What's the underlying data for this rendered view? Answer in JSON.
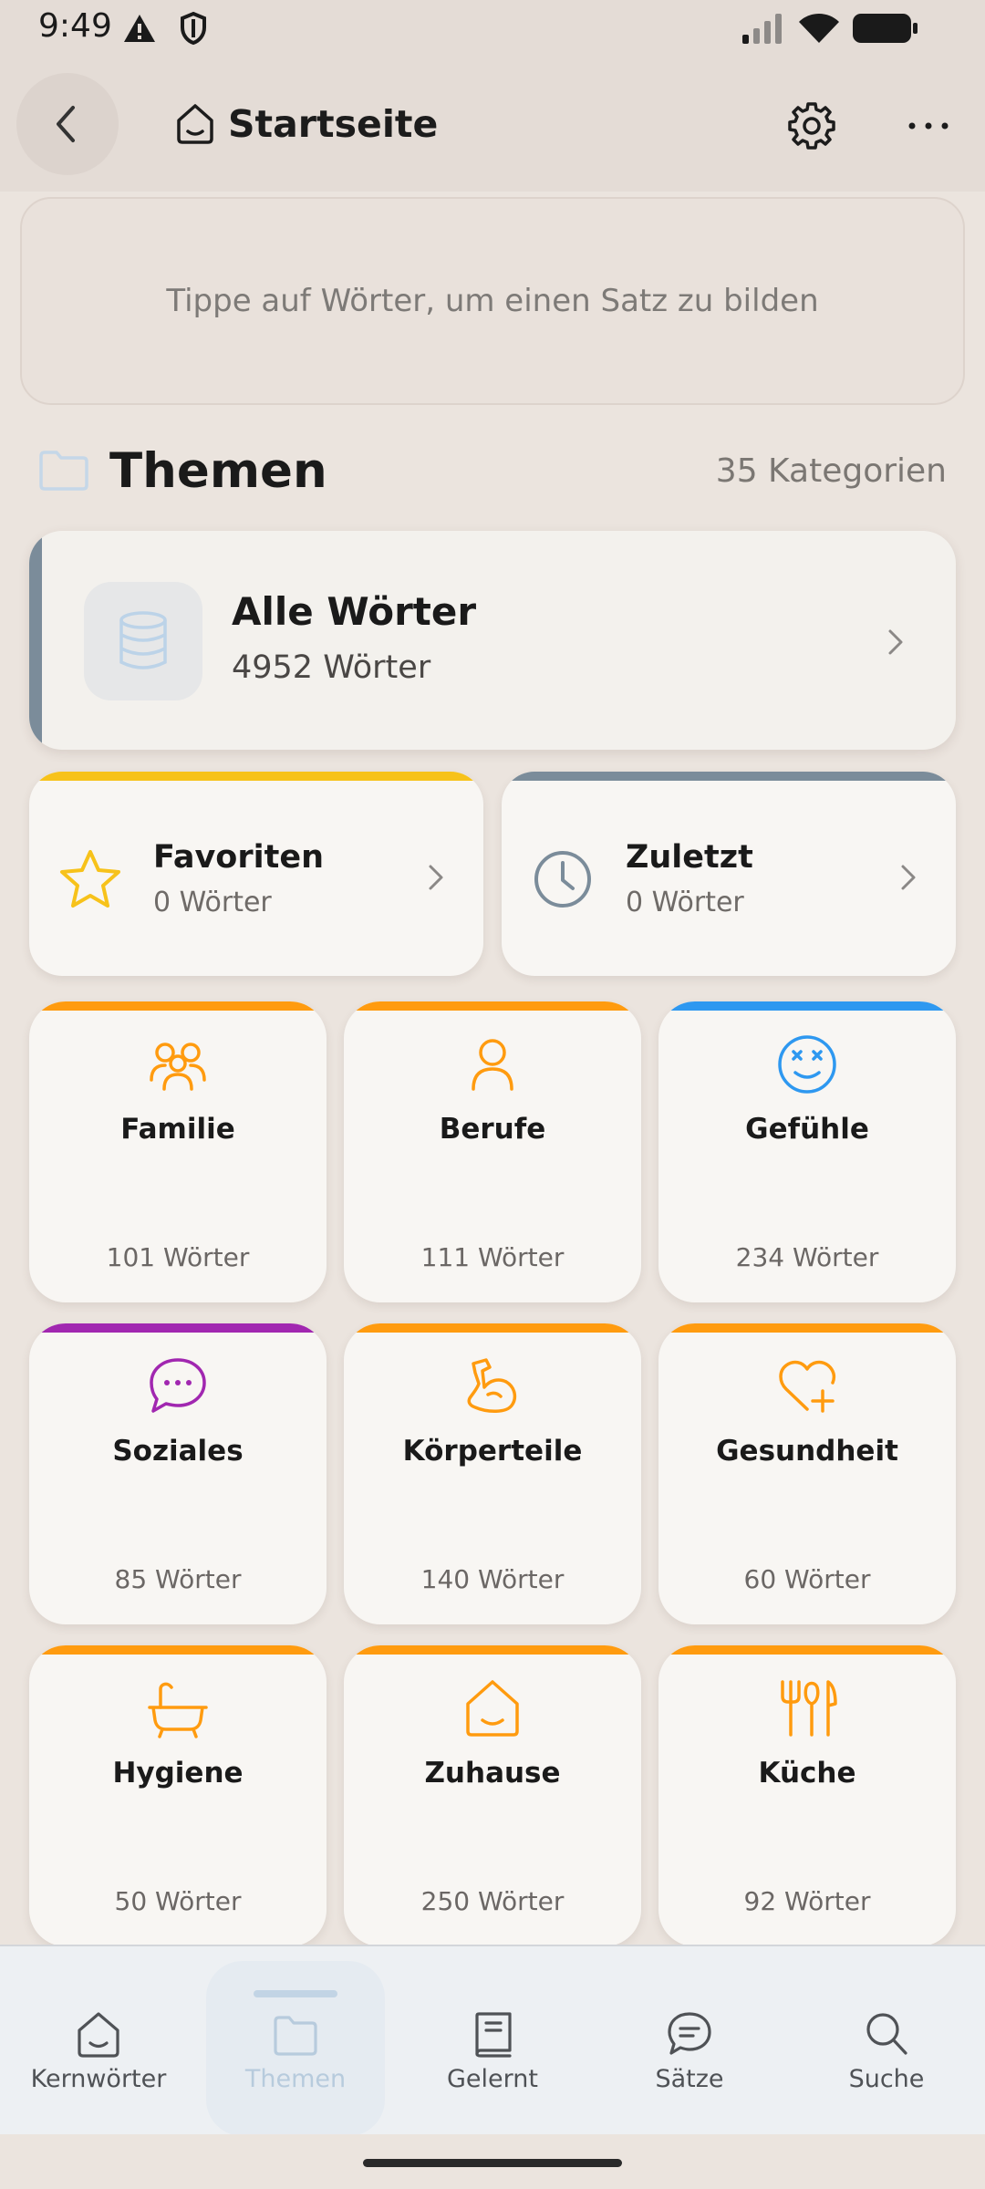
{
  "status_bar": {
    "time": "9:49",
    "icons": [
      "alert-icon",
      "shield-icon",
      "signal-icon",
      "wifi-icon",
      "battery-icon"
    ]
  },
  "app_bar": {
    "title": "Startseite",
    "icons": [
      "back-arrow-icon",
      "home-icon",
      "gear-icon",
      "more-dots-icon"
    ]
  },
  "sentence_box": {
    "placeholder": "Tippe auf Wörter, um einen Satz zu bilden"
  },
  "section": {
    "title": "Themen",
    "count": "35 Kategorien"
  },
  "all_words": {
    "title": "Alle Wörter",
    "subtitle": "4952 Wörter",
    "accent": "#7b8c9a"
  },
  "quick_cards": [
    {
      "label": "Favoriten",
      "count": "0 Wörter",
      "icon": "star-icon",
      "color": "#f7c21a"
    },
    {
      "label": "Zuletzt",
      "count": "0 Wörter",
      "icon": "clock-icon",
      "color": "#7b8c9a"
    }
  ],
  "categories": [
    {
      "label": "Familie",
      "count": "101 Wörter",
      "icon": "family-icon",
      "color": "#ff9b0f"
    },
    {
      "label": "Berufe",
      "count": "111 Wörter",
      "icon": "person-icon",
      "color": "#ff9b0f"
    },
    {
      "label": "Gefühle",
      "count": "234 Wörter",
      "icon": "emoji-face-icon",
      "color": "#2e98f0"
    },
    {
      "label": "Soziales",
      "count": "85 Wörter",
      "icon": "chat-bubble-icon",
      "color": "#a127b0"
    },
    {
      "label": "Körperteile",
      "count": "140 Wörter",
      "icon": "muscle-arm-icon",
      "color": "#ff9b0f"
    },
    {
      "label": "Gesundheit",
      "count": "60 Wörter",
      "icon": "heart-plus-icon",
      "color": "#ff9b0f"
    },
    {
      "label": "Hygiene",
      "count": "50 Wörter",
      "icon": "bathtub-icon",
      "color": "#ff9b0f"
    },
    {
      "label": "Zuhause",
      "count": "250 Wörter",
      "icon": "house-icon",
      "color": "#ff9b0f"
    },
    {
      "label": "Küche",
      "count": "92 Wörter",
      "icon": "utensils-icon",
      "color": "#ff9b0f"
    }
  ],
  "bottom_nav": [
    {
      "label": "Kernwörter",
      "icon": "home-icon",
      "active": false
    },
    {
      "label": "Themen",
      "icon": "folder-icon",
      "active": true
    },
    {
      "label": "Gelernt",
      "icon": "book-icon",
      "active": false
    },
    {
      "label": "Sätze",
      "icon": "chat-icon",
      "active": false
    },
    {
      "label": "Suche",
      "icon": "search-icon",
      "active": false
    }
  ]
}
